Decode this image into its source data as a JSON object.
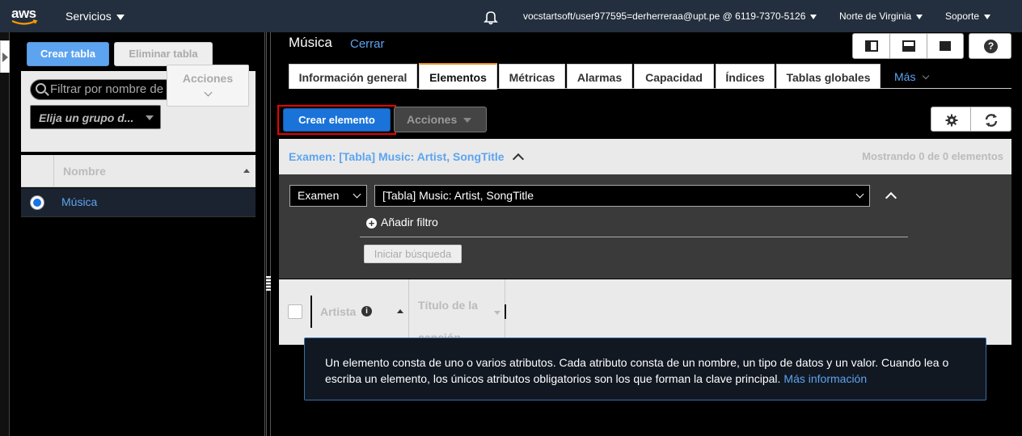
{
  "topnav": {
    "logo": "aws",
    "services": "Servicios",
    "account": "vocstartsoft/user977595=derherreraa@upt.pe @ 6119-7370-5126",
    "region": "Norte de Virginia",
    "support": "Soporte"
  },
  "sidebar": {
    "create_table": "Crear tabla",
    "delete_table": "Eliminar tabla",
    "filter_placeholder": "Filtrar por nombre de tabla",
    "group_select": "Elija un grupo d...",
    "actions": "Acciones",
    "column_name": "Nombre",
    "tables": [
      {
        "name": "Música",
        "selected": true
      }
    ]
  },
  "main": {
    "title": "Música",
    "close": "Cerrar",
    "tabs": [
      {
        "label": "Información general",
        "active": false
      },
      {
        "label": "Elementos",
        "active": true
      },
      {
        "label": "Métricas",
        "active": false
      },
      {
        "label": "Alarmas",
        "active": false
      },
      {
        "label": "Capacidad",
        "active": false
      },
      {
        "label": "Índices",
        "active": false
      },
      {
        "label": "Tablas globales",
        "active": false
      }
    ],
    "more_tab": "Más",
    "create_item": "Crear elemento",
    "actions": "Acciones",
    "scan_header": "Examen: [Tabla] Music: Artist, SongTitle",
    "showing": "Mostrando 0 de 0 elementos",
    "scan_mode": "Examen",
    "scan_target": "[Tabla] Music: Artist, SongTitle",
    "add_filter": "Añadir filtro",
    "start_search": "Iniciar búsqueda",
    "columns": [
      "Artista",
      "Título de la canción"
    ],
    "info_text": "Un elemento consta de uno o varios atributos. Cada atributo consta de un nombre, un tipo de datos y un valor. Cuando lea o escriba un elemento, los únicos atributos obligatorios son los que forman la clave principal.",
    "info_link": "Más información"
  },
  "colors": {
    "nav_bg": "#232f3e",
    "link_blue": "#5da4f0",
    "primary_button": "#1a73d9",
    "active_tab_accent": "#e88c1a",
    "highlight_frame": "#e00000"
  }
}
